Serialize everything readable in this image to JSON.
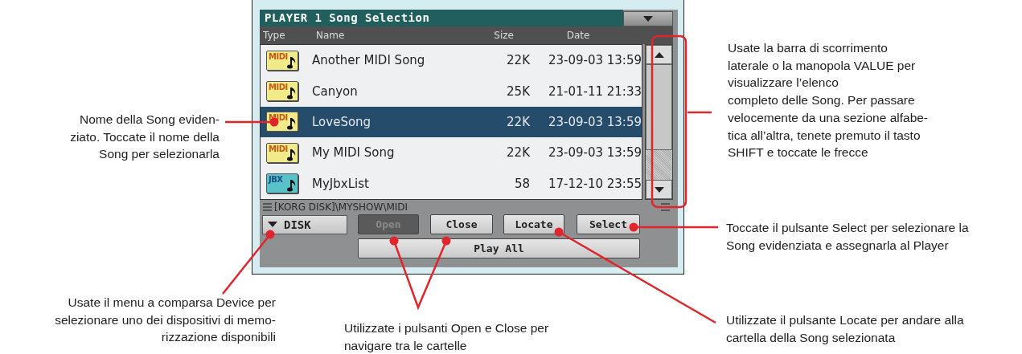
{
  "screen": {
    "title": "PLAYER 1 Song Selection",
    "columns": [
      "Type",
      "Name",
      "Size",
      "Date"
    ],
    "rows": [
      {
        "kind": "midi",
        "icon_label": "MIDI",
        "name": "Another MIDI Song",
        "size": "22K",
        "date": "23-09-03 13:59",
        "selected": false
      },
      {
        "kind": "midi",
        "icon_label": "MIDI",
        "name": "Canyon",
        "size": "25K",
        "date": "21-01-11 21:33",
        "selected": false
      },
      {
        "kind": "midi",
        "icon_label": "MIDI",
        "name": "LoveSong",
        "size": "22K",
        "date": "23-09-03 13:59",
        "selected": true
      },
      {
        "kind": "midi",
        "icon_label": "MIDI",
        "name": "My MIDI Song",
        "size": "22K",
        "date": "23-09-03 13:59",
        "selected": false
      },
      {
        "kind": "jbx",
        "icon_label": "JBX",
        "name": "MyJbxList",
        "size": "58",
        "date": "17-12-10 23:55",
        "selected": false
      }
    ],
    "path": "[KORG DISK]\\MYSHOW\\MIDI",
    "device_button": "DISK",
    "buttons": [
      {
        "label": "Open",
        "disabled": true
      },
      {
        "label": "Close",
        "disabled": false
      },
      {
        "label": "Locate",
        "disabled": false
      },
      {
        "label": "Select",
        "disabled": false
      }
    ],
    "play_all": "Play All"
  },
  "callouts": [
    {
      "text": "Nome della Song eviden-\nziato. Toccate il nome della\nSong per selezionarla"
    },
    {
      "text": "Usate la barra di scorrimento\nlaterale o la manopola VALUE per\nvisualizzare l’elenco\ncompleto delle Song. Per passare\nvelocemente da una sezione alfabe-\ntica all’altra, tenete premuto il tasto\nSHIFT e toccate le frecce"
    },
    {
      "text": "Toccate il pulsante Select per selezionare la\nSong evidenziata e assegnarla al Player"
    },
    {
      "text": "Usate il menu a comparsa Device per\nselezionare uno dei dispositivi di memo-\nrizzazione disponibili"
    },
    {
      "text": "Utilizzate i pulsanti Open e Close per\nnavigare tra le cartelle"
    },
    {
      "text": "Utilizzate il pulsante Locate per andare alla\ncartella della Song selezionata"
    }
  ]
}
